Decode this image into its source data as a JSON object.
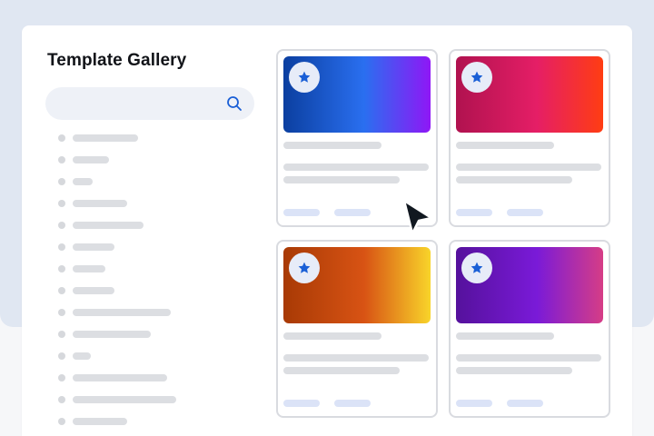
{
  "app": {
    "title": "Template Gallery"
  },
  "search": {
    "value": "",
    "icon": "search-icon"
  },
  "sidebar": {
    "item_count": 14
  },
  "gallery": {
    "cards": [
      {
        "name": "blue",
        "gradient": [
          "#0b3fa0",
          "#2a6ff0",
          "#8f17f6"
        ],
        "icon": "star-icon"
      },
      {
        "name": "pink",
        "gradient": [
          "#b0124f",
          "#e51e66",
          "#ff3d12"
        ],
        "icon": "star-icon"
      },
      {
        "name": "orange",
        "gradient": [
          "#a83a05",
          "#d85314",
          "#f8d42a"
        ],
        "icon": "star-icon"
      },
      {
        "name": "purple",
        "gradient": [
          "#55119c",
          "#7a1ad8",
          "#d63d86"
        ],
        "icon": "star-icon"
      }
    ]
  },
  "colors": {
    "accent": "#1a5fd6",
    "backdrop": "#e0e7f2",
    "skeleton": "#dcdee2",
    "tag": "#dbe3f7"
  },
  "cursor": {
    "icon": "arrow-cursor-icon"
  }
}
